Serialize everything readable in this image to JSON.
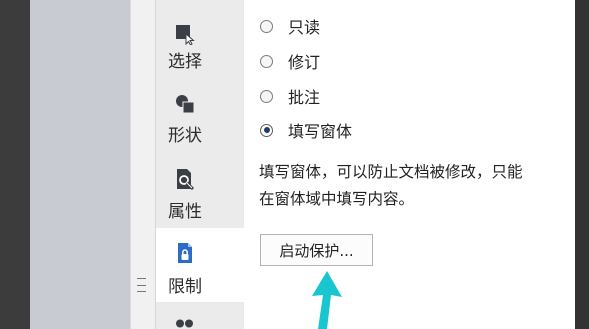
{
  "tool_rail": {
    "items": [
      {
        "label": "选择",
        "icon": "select-cursor-icon"
      },
      {
        "label": "形状",
        "icon": "shapes-icon"
      },
      {
        "label": "属性",
        "icon": "properties-icon"
      },
      {
        "label": "限制",
        "icon": "lock-document-icon"
      },
      {
        "label": "",
        "icon": "more-tools-icon"
      }
    ],
    "active_index": 3
  },
  "restrict_panel": {
    "options": [
      {
        "label": "只读",
        "checked": false
      },
      {
        "label": "修订",
        "checked": false
      },
      {
        "label": "批注",
        "checked": false
      },
      {
        "label": "填写窗体",
        "checked": true
      }
    ],
    "description_lines": [
      "填写窗体，可以防止文档被修改，只能",
      "在窗体域中填写内容。"
    ],
    "start_protection_label": "启动保护..."
  },
  "colors": {
    "accent_arrow": "#19c6cf",
    "icon_dark": "#3b3f45",
    "icon_blue": "#2b6cc4"
  }
}
